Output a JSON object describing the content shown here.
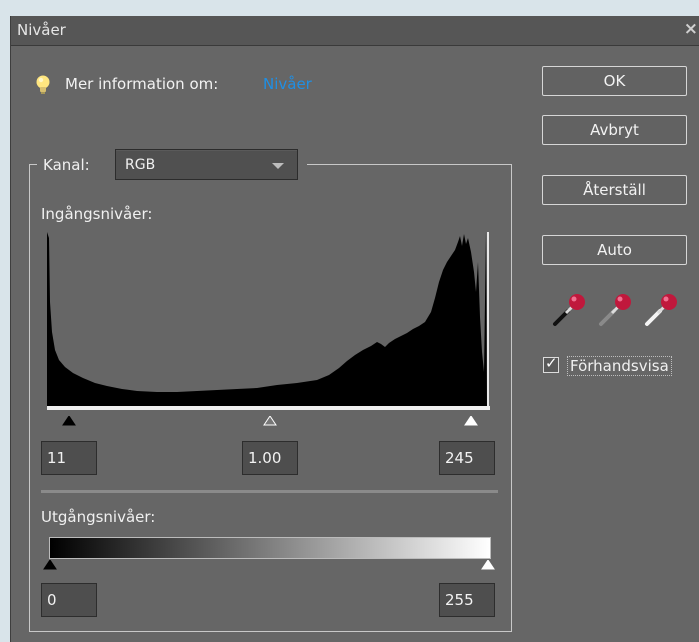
{
  "dialog": {
    "title": "Nivåer",
    "close_glyph": "×",
    "info_label": "Mer information om:",
    "info_link": "Nivåer",
    "channel_label": "Kanal:",
    "channel_value": "RGB",
    "input_levels_label": "Ingångsnivåer:",
    "output_levels_label": "Utgångsnivåer:",
    "input_black": "11",
    "input_gamma": "1.00",
    "input_white": "245",
    "output_black": "0",
    "output_white": "255",
    "preview_label": "Förhandsvisa",
    "preview_checked": true
  },
  "buttons": {
    "ok": "OK",
    "cancel": "Avbryt",
    "reset": "Återställ",
    "auto": "Auto"
  },
  "icons": {
    "info": "lightbulb-icon",
    "droppers": [
      "black-point-eyedropper-icon",
      "gray-point-eyedropper-icon",
      "white-point-eyedropper-icon"
    ]
  },
  "colors": {
    "dialog_bg": "#666666",
    "link": "#1f8fe4",
    "dropper_red": "#c0183c"
  }
}
